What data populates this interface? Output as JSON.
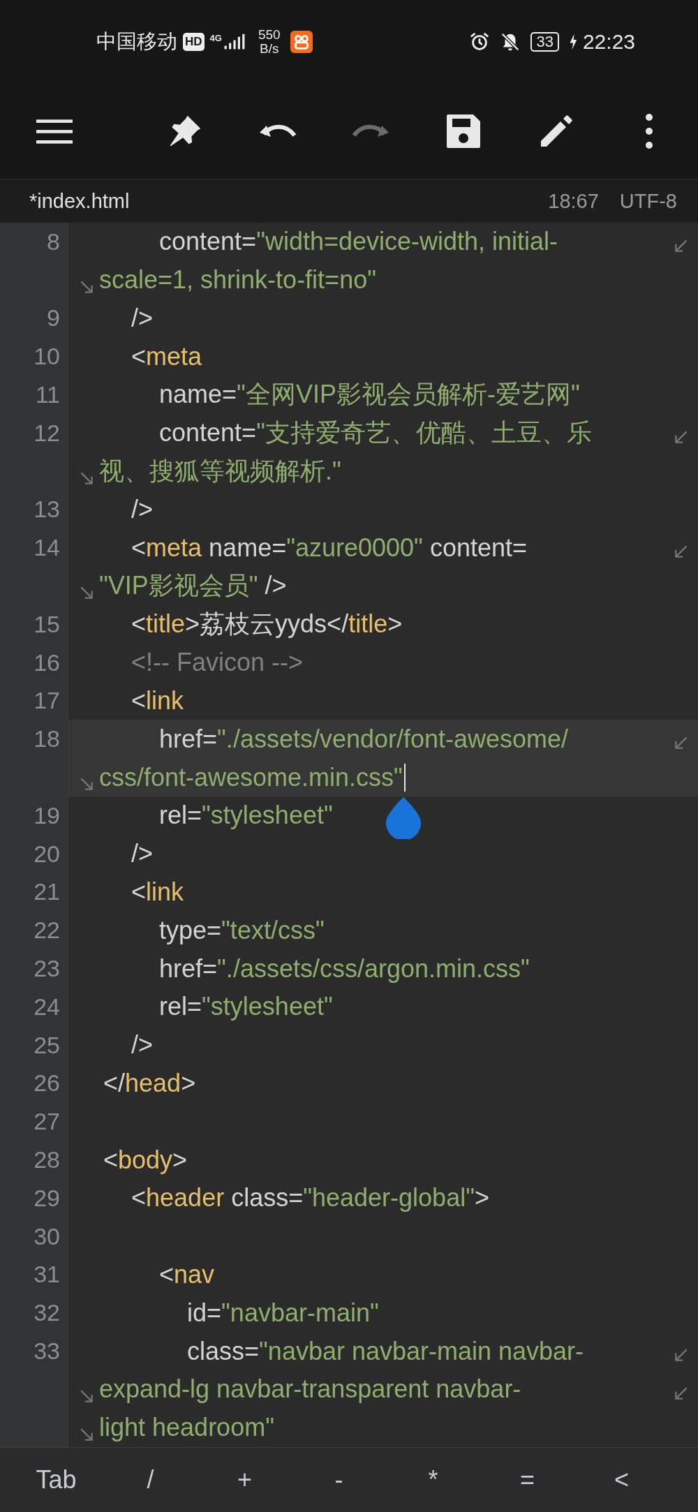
{
  "status_bar": {
    "carrier": "中国移动",
    "hd_badge": "HD",
    "network_type": "4G",
    "speed_value": "550",
    "speed_unit": "B/s",
    "battery": "33",
    "charging": true,
    "time": "22:23"
  },
  "toolbar": {
    "undo": {
      "disabled": false
    },
    "redo": {
      "disabled": true
    }
  },
  "file_bar": {
    "filename": "*index.html",
    "position": "18:67",
    "encoding": "UTF-8"
  },
  "editor": {
    "rows": [
      {
        "number": "8",
        "continued": false,
        "wraps": true,
        "current": false,
        "cursor": false,
        "tokens": [
          {
            "kind": "plain",
            "text": "            content="
          },
          {
            "kind": "str",
            "text": "\"width=device-width, initial-"
          }
        ]
      },
      {
        "continued": true,
        "wraps": false,
        "current": false,
        "cursor": false,
        "tokens": [
          {
            "kind": "str",
            "text": "scale=1, shrink-to-fit=no\""
          }
        ]
      },
      {
        "number": "9",
        "continued": false,
        "wraps": false,
        "current": false,
        "cursor": false,
        "tokens": [
          {
            "kind": "plain",
            "text": "        />"
          }
        ]
      },
      {
        "number": "10",
        "continued": false,
        "wraps": false,
        "current": false,
        "cursor": false,
        "tokens": [
          {
            "kind": "plain",
            "text": "        <"
          },
          {
            "kind": "tag",
            "text": "meta"
          }
        ]
      },
      {
        "number": "11",
        "continued": false,
        "wraps": false,
        "current": false,
        "cursor": false,
        "tokens": [
          {
            "kind": "plain",
            "text": "            name="
          },
          {
            "kind": "str",
            "text": "\"全网VIP影视会员解析-爱艺网\""
          }
        ]
      },
      {
        "number": "12",
        "continued": false,
        "wraps": true,
        "current": false,
        "cursor": false,
        "tokens": [
          {
            "kind": "plain",
            "text": "            content="
          },
          {
            "kind": "str",
            "text": "\"支持爱奇艺、优酷、土豆、乐"
          }
        ]
      },
      {
        "continued": true,
        "wraps": false,
        "current": false,
        "cursor": false,
        "tokens": [
          {
            "kind": "str",
            "text": "视、搜狐等视频解析.\""
          }
        ]
      },
      {
        "number": "13",
        "continued": false,
        "wraps": false,
        "current": false,
        "cursor": false,
        "tokens": [
          {
            "kind": "plain",
            "text": "        />"
          }
        ]
      },
      {
        "number": "14",
        "continued": false,
        "wraps": true,
        "current": false,
        "cursor": false,
        "tokens": [
          {
            "kind": "plain",
            "text": "        <"
          },
          {
            "kind": "tag",
            "text": "meta"
          },
          {
            "kind": "plain",
            "text": " name="
          },
          {
            "kind": "str",
            "text": "\"azure0000\""
          },
          {
            "kind": "plain",
            "text": " content="
          }
        ]
      },
      {
        "continued": true,
        "wraps": false,
        "current": false,
        "cursor": false,
        "tokens": [
          {
            "kind": "str",
            "text": "\"VIP影视会员\""
          },
          {
            "kind": "plain",
            "text": " />"
          }
        ]
      },
      {
        "number": "15",
        "continued": false,
        "wraps": false,
        "current": false,
        "cursor": false,
        "tokens": [
          {
            "kind": "plain",
            "text": "        <"
          },
          {
            "kind": "tag",
            "text": "title"
          },
          {
            "kind": "plain",
            "text": ">荔枝云yyds</"
          },
          {
            "kind": "tag",
            "text": "title"
          },
          {
            "kind": "plain",
            "text": ">"
          }
        ]
      },
      {
        "number": "16",
        "continued": false,
        "wraps": false,
        "current": false,
        "cursor": false,
        "tokens": [
          {
            "kind": "comment",
            "text": "        <!-- Favicon -->"
          }
        ]
      },
      {
        "number": "17",
        "continued": false,
        "wraps": false,
        "current": false,
        "cursor": false,
        "tokens": [
          {
            "kind": "plain",
            "text": "        <"
          },
          {
            "kind": "tag",
            "text": "link"
          }
        ]
      },
      {
        "number": "18",
        "continued": false,
        "wraps": true,
        "current": true,
        "cursor": false,
        "tokens": [
          {
            "kind": "plain",
            "text": "            href="
          },
          {
            "kind": "str",
            "text": "\"./assets/vendor/font-awesome/"
          }
        ]
      },
      {
        "continued": true,
        "wraps": false,
        "current": true,
        "cursor": true,
        "tokens": [
          {
            "kind": "str",
            "text": "css/font-awesome.min.css\""
          }
        ]
      },
      {
        "number": "19",
        "continued": false,
        "wraps": false,
        "current": false,
        "cursor": false,
        "tokens": [
          {
            "kind": "plain",
            "text": "            rel="
          },
          {
            "kind": "str",
            "text": "\"stylesheet\""
          }
        ]
      },
      {
        "number": "20",
        "continued": false,
        "wraps": false,
        "current": false,
        "cursor": false,
        "tokens": [
          {
            "kind": "plain",
            "text": "        />"
          }
        ]
      },
      {
        "number": "21",
        "continued": false,
        "wraps": false,
        "current": false,
        "cursor": false,
        "tokens": [
          {
            "kind": "plain",
            "text": "        <"
          },
          {
            "kind": "tag",
            "text": "link"
          }
        ]
      },
      {
        "number": "22",
        "continued": false,
        "wraps": false,
        "current": false,
        "cursor": false,
        "tokens": [
          {
            "kind": "plain",
            "text": "            type="
          },
          {
            "kind": "str",
            "text": "\"text/css\""
          }
        ]
      },
      {
        "number": "23",
        "continued": false,
        "wraps": false,
        "current": false,
        "cursor": false,
        "tokens": [
          {
            "kind": "plain",
            "text": "            href="
          },
          {
            "kind": "str",
            "text": "\"./assets/css/argon.min.css\""
          }
        ]
      },
      {
        "number": "24",
        "continued": false,
        "wraps": false,
        "current": false,
        "cursor": false,
        "tokens": [
          {
            "kind": "plain",
            "text": "            rel="
          },
          {
            "kind": "str",
            "text": "\"stylesheet\""
          }
        ]
      },
      {
        "number": "25",
        "continued": false,
        "wraps": false,
        "current": false,
        "cursor": false,
        "tokens": [
          {
            "kind": "plain",
            "text": "        />"
          }
        ]
      },
      {
        "number": "26",
        "continued": false,
        "wraps": false,
        "current": false,
        "cursor": false,
        "tokens": [
          {
            "kind": "plain",
            "text": "    </"
          },
          {
            "kind": "tag",
            "text": "head"
          },
          {
            "kind": "plain",
            "text": ">"
          }
        ]
      },
      {
        "number": "27",
        "continued": false,
        "wraps": false,
        "current": false,
        "cursor": false
      },
      {
        "number": "28",
        "continued": false,
        "wraps": false,
        "current": false,
        "cursor": false,
        "tokens": [
          {
            "kind": "plain",
            "text": "    <"
          },
          {
            "kind": "tag",
            "text": "body"
          },
          {
            "kind": "plain",
            "text": ">"
          }
        ]
      },
      {
        "number": "29",
        "continued": false,
        "wraps": false,
        "current": false,
        "cursor": false,
        "tokens": [
          {
            "kind": "plain",
            "text": "        <"
          },
          {
            "kind": "tag",
            "text": "header"
          },
          {
            "kind": "plain",
            "text": " class="
          },
          {
            "kind": "str",
            "text": "\"header-global\""
          },
          {
            "kind": "plain",
            "text": ">"
          }
        ]
      },
      {
        "number": "30",
        "continued": false,
        "wraps": false,
        "current": false,
        "cursor": false
      },
      {
        "number": "31",
        "continued": false,
        "wraps": false,
        "current": false,
        "cursor": false,
        "tokens": [
          {
            "kind": "plain",
            "text": "            <"
          },
          {
            "kind": "tag",
            "text": "nav"
          }
        ]
      },
      {
        "number": "32",
        "continued": false,
        "wraps": false,
        "current": false,
        "cursor": false,
        "tokens": [
          {
            "kind": "plain",
            "text": "                id="
          },
          {
            "kind": "str",
            "text": "\"navbar-main\""
          }
        ]
      },
      {
        "number": "33",
        "continued": false,
        "wraps": true,
        "current": false,
        "cursor": false,
        "tokens": [
          {
            "kind": "plain",
            "text": "                class="
          },
          {
            "kind": "str",
            "text": "\"navbar navbar-main navbar-"
          }
        ]
      },
      {
        "continued": true,
        "wraps": true,
        "current": false,
        "cursor": false,
        "tokens": [
          {
            "kind": "str",
            "text": "expand-lg navbar-transparent navbar-"
          }
        ]
      },
      {
        "continued": true,
        "wraps": false,
        "current": false,
        "cursor": false,
        "tokens": [
          {
            "kind": "str",
            "text": "light headroom\""
          }
        ]
      }
    ]
  },
  "keys": [
    "Tab",
    "/",
    "+",
    "-",
    "*",
    "=",
    "<"
  ]
}
